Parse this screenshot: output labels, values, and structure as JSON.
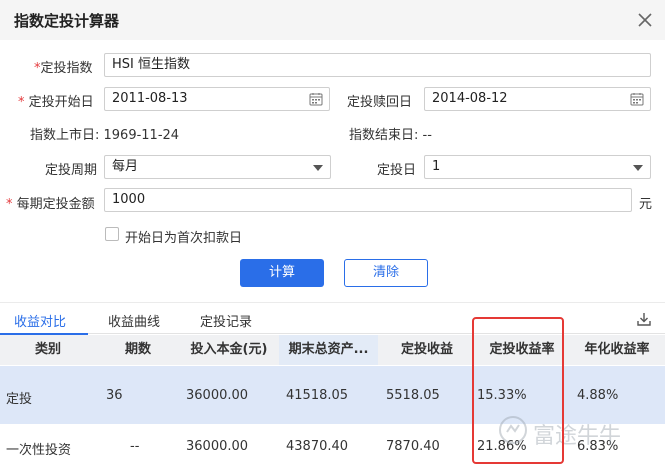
{
  "dialog": {
    "title": "指数定投计算器"
  },
  "form": {
    "index_label": "定投指数",
    "index_value": "HSI 恒生指数",
    "start_label": "定投开始日",
    "start_value": "2011-08-13",
    "redeem_label": "定投赎回日",
    "redeem_value": "2014-08-12",
    "listing_date_text": "指数上市日: 1969-11-24",
    "end_date_text": "指数结束日: --",
    "period_label": "定投周期",
    "period_value": "每月",
    "day_label": "定投日",
    "day_value": "1",
    "amount_label": "每期定投金额",
    "amount_value": "1000",
    "amount_unit": "元",
    "first_deduct_label": "开始日为首次扣款日",
    "required_mark": "*"
  },
  "buttons": {
    "calculate": "计算",
    "clear": "清除"
  },
  "tabs": [
    {
      "label": "收益对比",
      "active": true
    },
    {
      "label": "收益曲线",
      "active": false
    },
    {
      "label": "定投记录",
      "active": false
    }
  ],
  "table": {
    "headers": [
      "类别",
      "期数",
      "投入本金(元)",
      "期末总资产...",
      "定投收益",
      "定投收益率",
      "年化收益率"
    ],
    "rows": [
      [
        "定投",
        "36",
        "36000.00",
        "41518.05",
        "5518.05",
        "15.33%",
        "4.88%"
      ],
      [
        "一次性投资",
        "--",
        "36000.00",
        "43870.40",
        "7870.40",
        "21.86%",
        "6.83%"
      ]
    ]
  },
  "watermark": {
    "text": "富途牛牛"
  },
  "colors": {
    "accent": "#2a6ee8",
    "required": "#e4393c",
    "highlight_box": "#e53935",
    "selected_row": "#dde7f8"
  },
  "icons": [
    "close-icon",
    "calendar-icon",
    "chevron-down-icon",
    "download-icon",
    "futu-logo-icon"
  ]
}
